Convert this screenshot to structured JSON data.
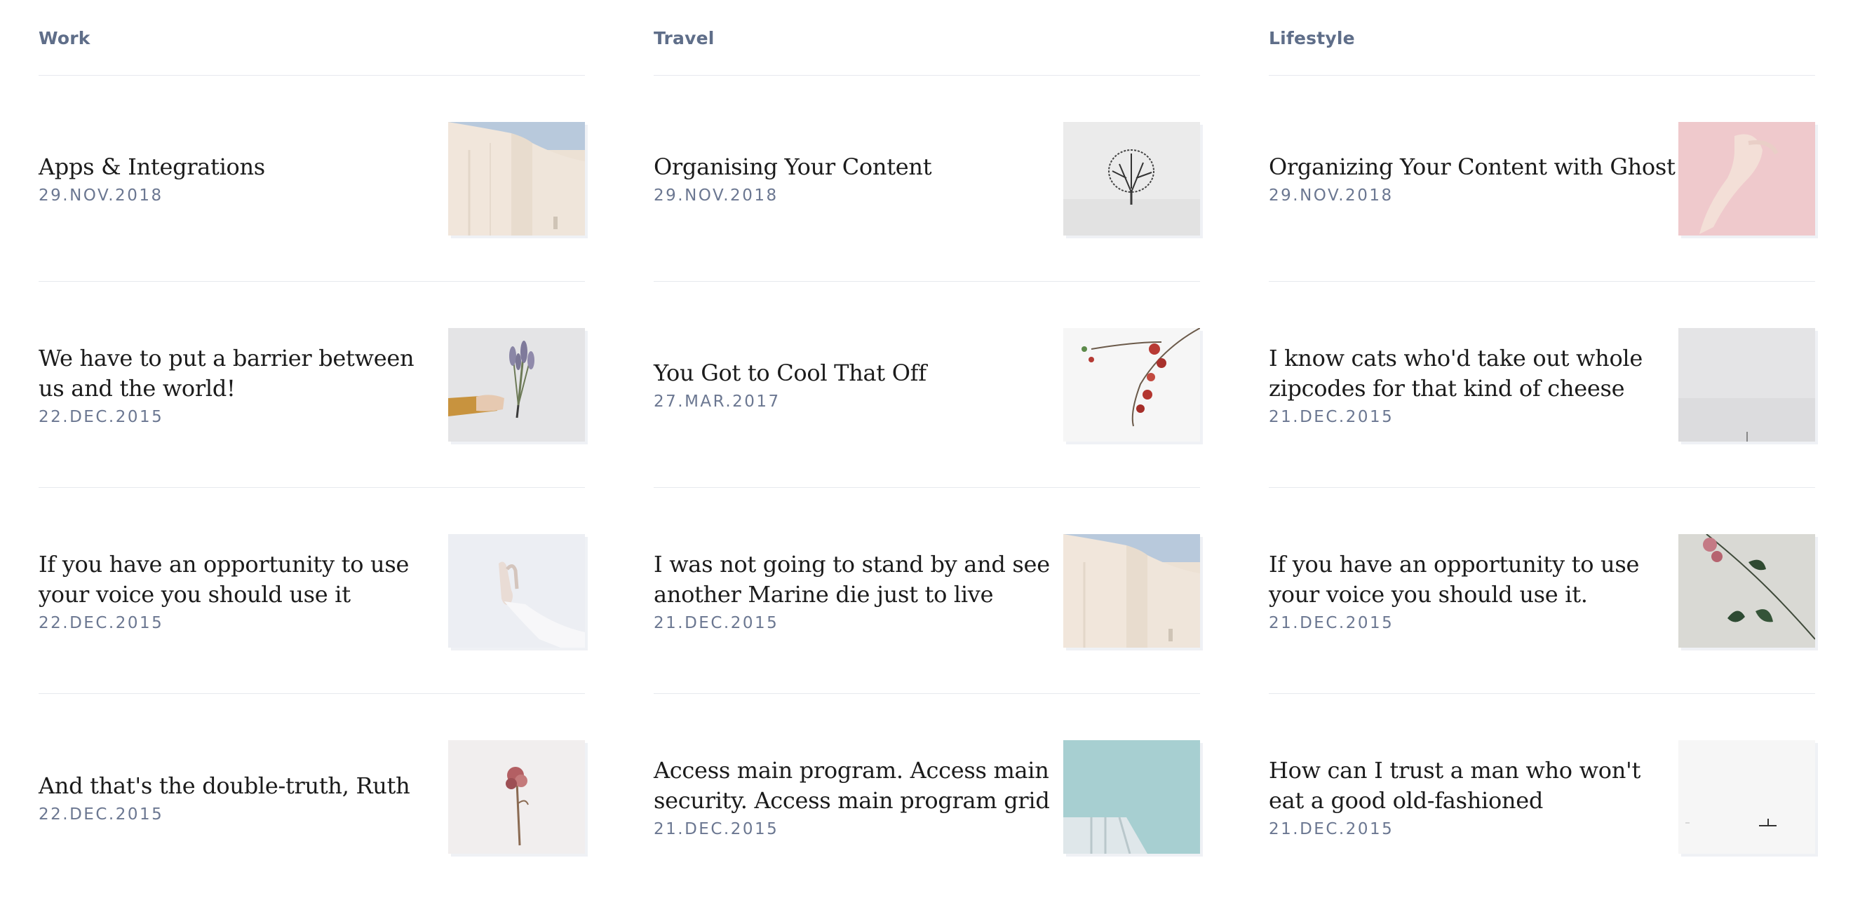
{
  "columns": [
    {
      "title": "Work",
      "posts": [
        {
          "title": "Apps & Integrations",
          "date": "29.NOV.2018",
          "image": "white-curtain-sky"
        },
        {
          "title": "We have to put a barrier between us and the world!",
          "date": "22.DEC.2015",
          "image": "hand-holding-lavender"
        },
        {
          "title": "If you have an opportunity to use your voice you should use it",
          "date": "22.DEC.2015",
          "image": "hand-gesture"
        },
        {
          "title": "And that's the double-truth, Ruth",
          "date": "22.DEC.2015",
          "image": "dried-rose"
        }
      ]
    },
    {
      "title": "Travel",
      "posts": [
        {
          "title": "Organising Your Content",
          "date": "29.NOV.2018",
          "image": "lone-tree-snow"
        },
        {
          "title": "You Got to Cool That Off",
          "date": "27.MAR.2017",
          "image": "red-blossom-branch"
        },
        {
          "title": "I was not going to stand by and see another Marine die just to live",
          "date": "21.DEC.2015",
          "image": "white-curtain-sky"
        },
        {
          "title": "Access main program. Access main security. Access main program grid",
          "date": "21.DEC.2015",
          "image": "white-building-sky"
        }
      ]
    },
    {
      "title": "Lifestyle",
      "posts": [
        {
          "title": "Organizing Your Content with Ghost",
          "date": "29.NOV.2018",
          "image": "hand-on-pink"
        },
        {
          "title": "I know cats who'd take out whole zipcodes for that kind of cheese",
          "date": "21.DEC.2015",
          "image": "foggy-horizon"
        },
        {
          "title": "If you have an opportunity to use your voice you should use it.",
          "date": "21.DEC.2015",
          "image": "pink-flower-stem"
        },
        {
          "title": "How can I trust a man who won't eat a good old-fashioned",
          "date": "21.DEC.2015",
          "image": "minimal-boat"
        }
      ]
    }
  ]
}
